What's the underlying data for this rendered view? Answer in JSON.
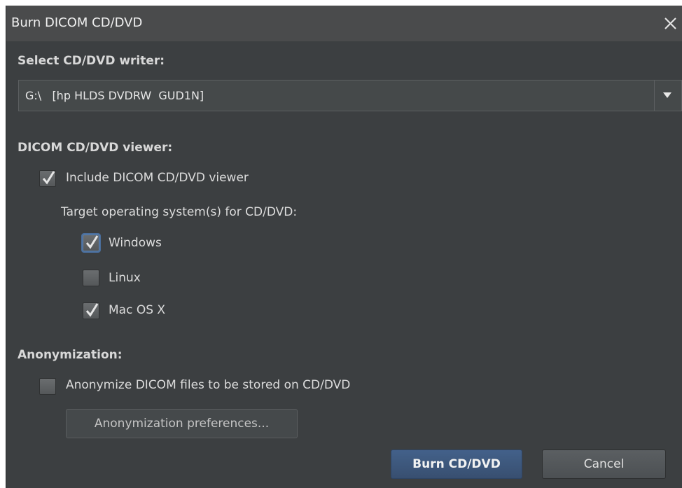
{
  "window": {
    "title": "Burn DICOM CD/DVD",
    "close_symbol": "✕"
  },
  "writer": {
    "heading": "Select CD/DVD writer:",
    "selected": "G:\\   [hp HLDS DVDRW  GUD1N]"
  },
  "viewer": {
    "heading": "DICOM CD/DVD viewer:",
    "include_label": "Include DICOM CD/DVD viewer",
    "include_checked": true,
    "target_os_label": "Target operating system(s) for CD/DVD:",
    "os_options": [
      {
        "label": "Windows",
        "checked": true
      },
      {
        "label": "Linux",
        "checked": false
      },
      {
        "label": "Mac OS X",
        "checked": true
      }
    ]
  },
  "anonymization": {
    "heading": "Anonymization:",
    "anonymize_label": "Anonymize DICOM files to be stored on CD/DVD",
    "anonymize_checked": false,
    "preferences_button": "Anonymization preferences..."
  },
  "buttons": {
    "burn": "Burn CD/DVD",
    "cancel": "Cancel"
  },
  "colors": {
    "background": "#3c3f41",
    "titlebar": "#4a4b4c",
    "accent": "#43618a"
  }
}
